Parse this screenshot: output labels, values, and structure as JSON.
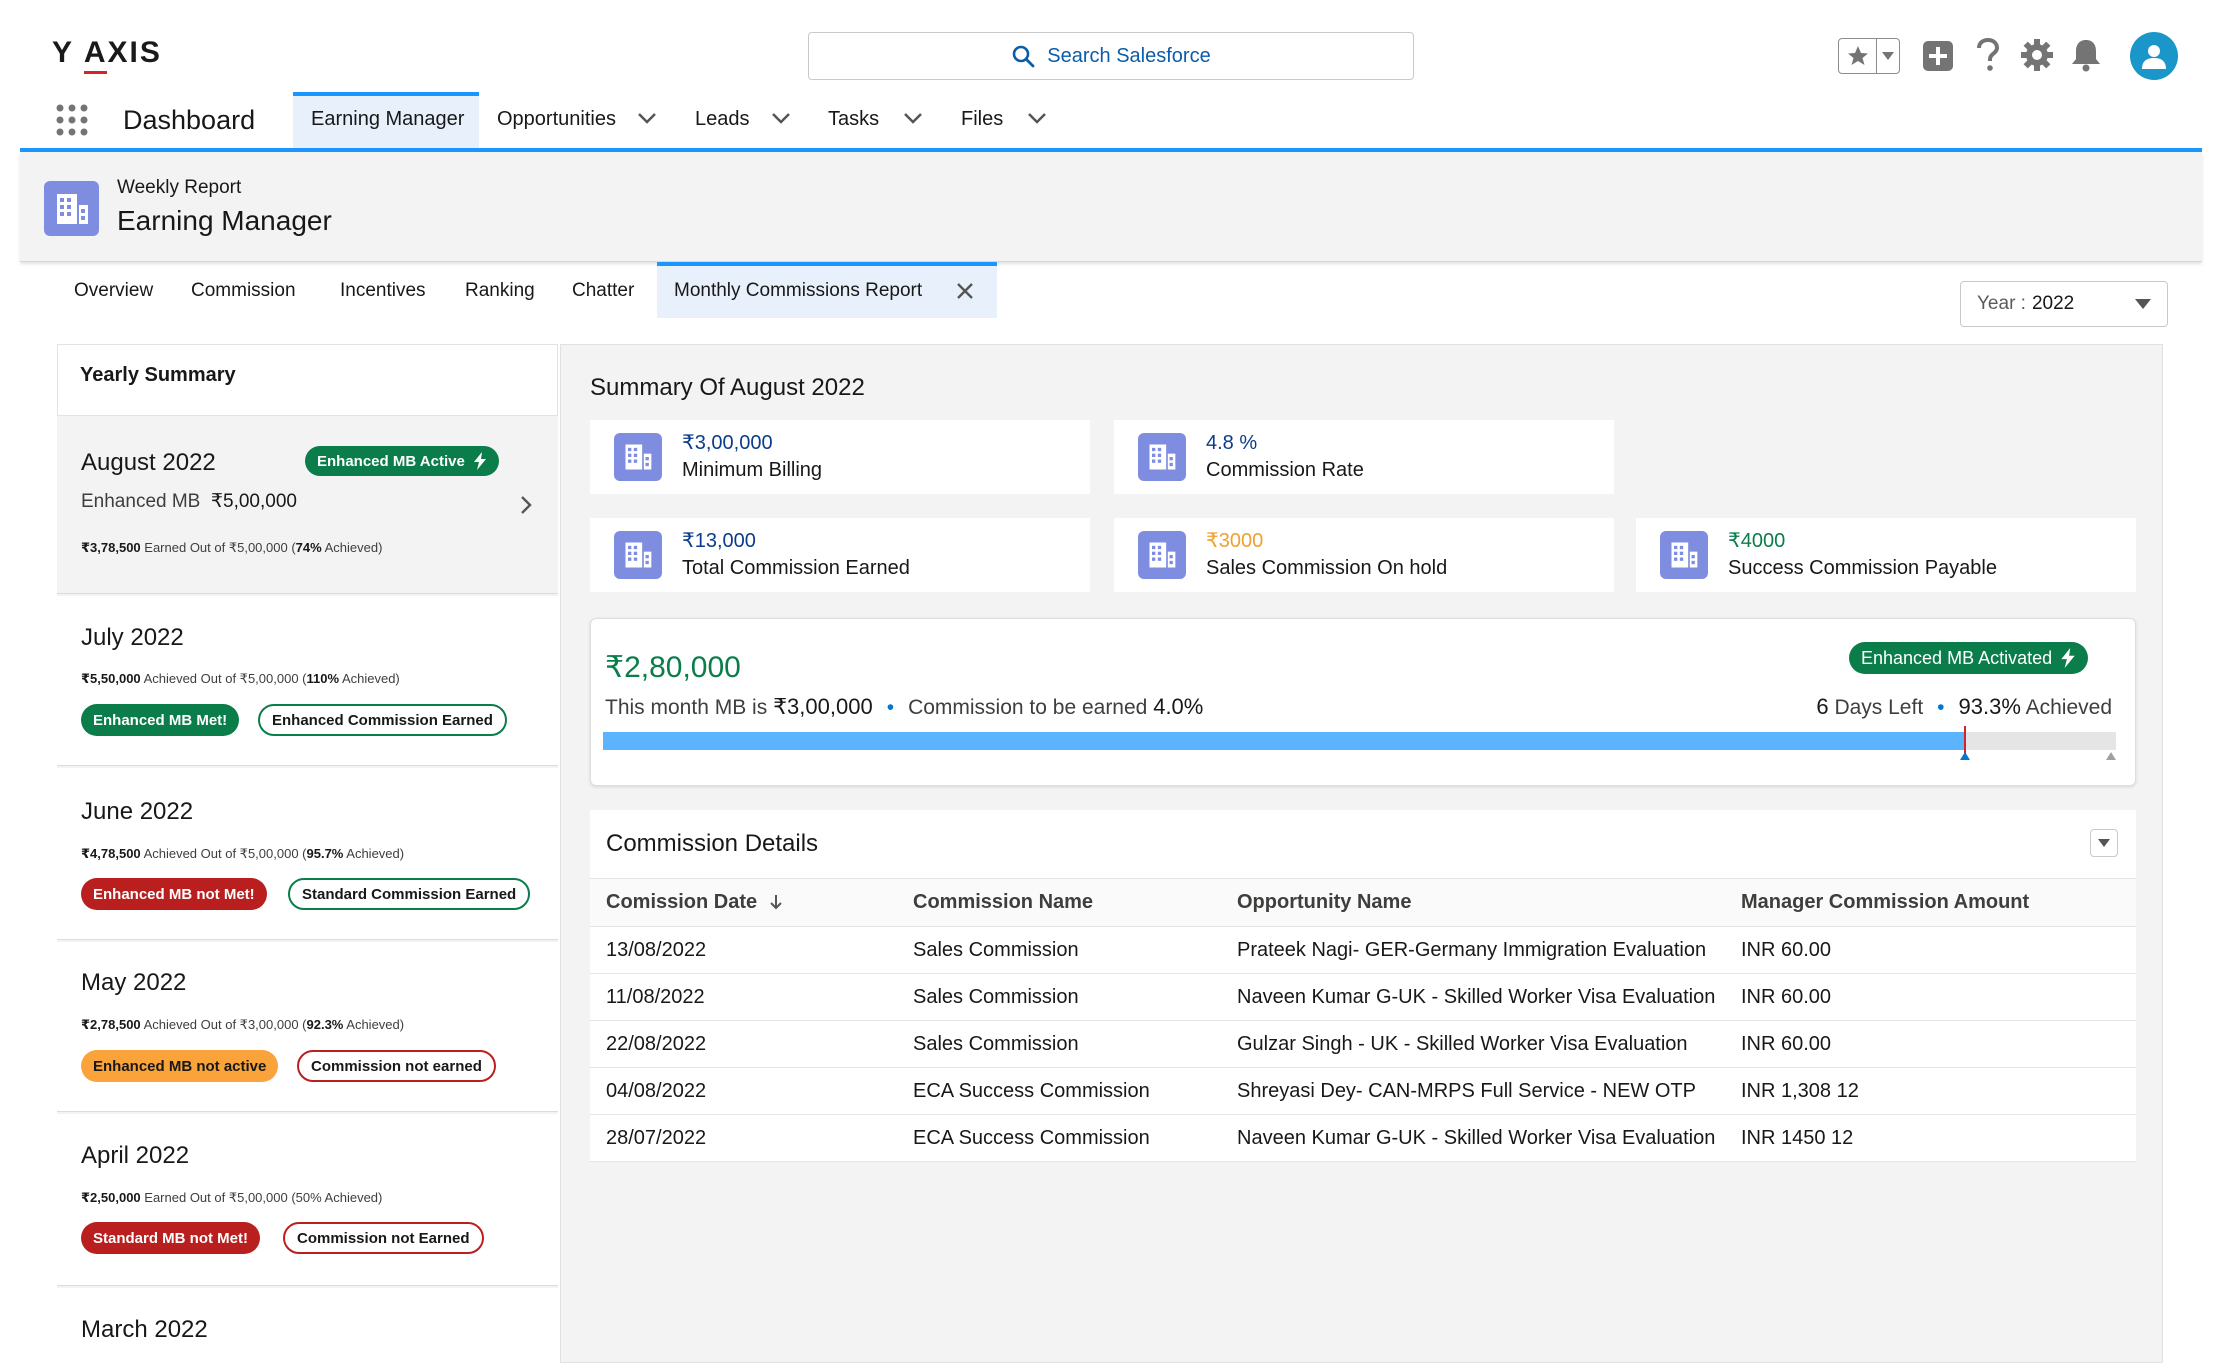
{
  "header": {
    "logo_y": "Y",
    "logo_a": "A",
    "logo_xis": "XIS",
    "search_placeholder": "Search Salesforce"
  },
  "nav": {
    "app_name": "Dashboard",
    "items": [
      {
        "label": "Earning Manager"
      },
      {
        "label": "Opportunities"
      },
      {
        "label": "Leads"
      },
      {
        "label": "Tasks"
      },
      {
        "label": "Files"
      }
    ]
  },
  "page_header": {
    "subtitle": "Weekly Report",
    "title": "Earning Manager"
  },
  "subtabs": [
    {
      "label": "Overview"
    },
    {
      "label": "Commission"
    },
    {
      "label": "Incentives"
    },
    {
      "label": "Ranking"
    },
    {
      "label": "Chatter"
    },
    {
      "label": "Monthly Commissions Report"
    }
  ],
  "year_select": {
    "prefix": "Year :",
    "value": "2022"
  },
  "yearly_summary": {
    "title": "Yearly Summary",
    "months": [
      {
        "title": "August 2022",
        "badge": "Enhanced MB Active",
        "mb_label": "Enhanced MB",
        "mb_value": "₹5,00,000",
        "earned": "₹3,78,500",
        "mid": "Earned Out of ₹5,00,000 (",
        "pct": "74%",
        "tail": "Achieved)"
      },
      {
        "title": "July 2022",
        "earned": "₹5,50,000",
        "mid": "Achieved Out of ₹5,00,000 (",
        "pct": "110%",
        "tail": "Achieved)",
        "badge1": "Enhanced MB Met!",
        "badge2": "Enhanced Commission Earned"
      },
      {
        "title": "June 2022",
        "earned": "₹4,78,500",
        "mid": "Achieved Out of ₹5,00,000 (",
        "pct": "95.7%",
        "tail": "Achieved)",
        "badge1": "Enhanced MB not Met!",
        "badge2": "Standard Commission Earned"
      },
      {
        "title": "May 2022",
        "earned": "₹2,78,500",
        "mid": "Achieved Out of ₹3,00,000 (",
        "pct": "92.3%",
        "tail": "Achieved)",
        "badge1": "Enhanced MB not active",
        "badge2": "Commission not earned"
      },
      {
        "title": "April 2022",
        "earned": "₹2,50,000",
        "mid": "Earned Out of ₹5,00,000 (50% Achieved)",
        "badge1": "Standard MB not Met!",
        "badge2": "Commission not Earned"
      },
      {
        "title": "March 2022"
      }
    ]
  },
  "summary": {
    "title": "Summary Of August 2022",
    "stats": [
      {
        "value": "₹3,00,000",
        "label": "Minimum Billing",
        "color": "#0b3c8c"
      },
      {
        "value": "4.8 %",
        "label": "Commission Rate",
        "color": "#0b3c8c"
      },
      {
        "value": "₹13,000",
        "label": "Total Commission Earned",
        "color": "#0b3c8c"
      },
      {
        "value": "₹3000",
        "label": "Sales Commission On hold",
        "color": "#f0a030"
      },
      {
        "value": "₹4000",
        "label": "Success Commission Payable",
        "color": "#0a7d4a"
      }
    ]
  },
  "mb_card": {
    "amount": "₹2,80,000",
    "line_prefix": "This month MB is",
    "line_mb": "₹3,00,000",
    "line_mid": "Commission to be earned",
    "line_rate": "4.0%",
    "days_num": "6",
    "days_text": "Days Left",
    "pct": "93.3%",
    "pct_text": "Achieved",
    "badge": "Enhanced MB Activated",
    "progress": 0.9
  },
  "details": {
    "title": "Commission Details",
    "columns": [
      "Comission Date",
      "Commission Name",
      "Opportunity Name",
      "Manager Commission Amount"
    ],
    "rows": [
      [
        "13/08/2022",
        "Sales Commission",
        "Prateek Nagi- GER-Germany Immigration Evaluation",
        "INR 60.00"
      ],
      [
        "11/08/2022",
        "Sales Commission",
        "Naveen Kumar G-UK - Skilled Worker Visa Evaluation",
        "INR 60.00"
      ],
      [
        "22/08/2022",
        "Sales Commission",
        "Gulzar Singh - UK - Skilled Worker Visa Evaluation",
        "INR 60.00"
      ],
      [
        "04/08/2022",
        "ECA Success Commission",
        "Shreyasi Dey- CAN-MRPS Full Service - NEW OTP",
        "INR 1,308 12"
      ],
      [
        "28/07/2022",
        "ECA Success Commission",
        "Naveen Kumar G-UK - Skilled Worker Visa Evaluation",
        "INR 1450 12"
      ]
    ]
  },
  "colors": {
    "brand_blue": "#1b96ff",
    "green": "#0a7d4a",
    "red": "#ba1f1f",
    "orange": "#f9a33a",
    "icon_purple": "#7f8de1"
  }
}
